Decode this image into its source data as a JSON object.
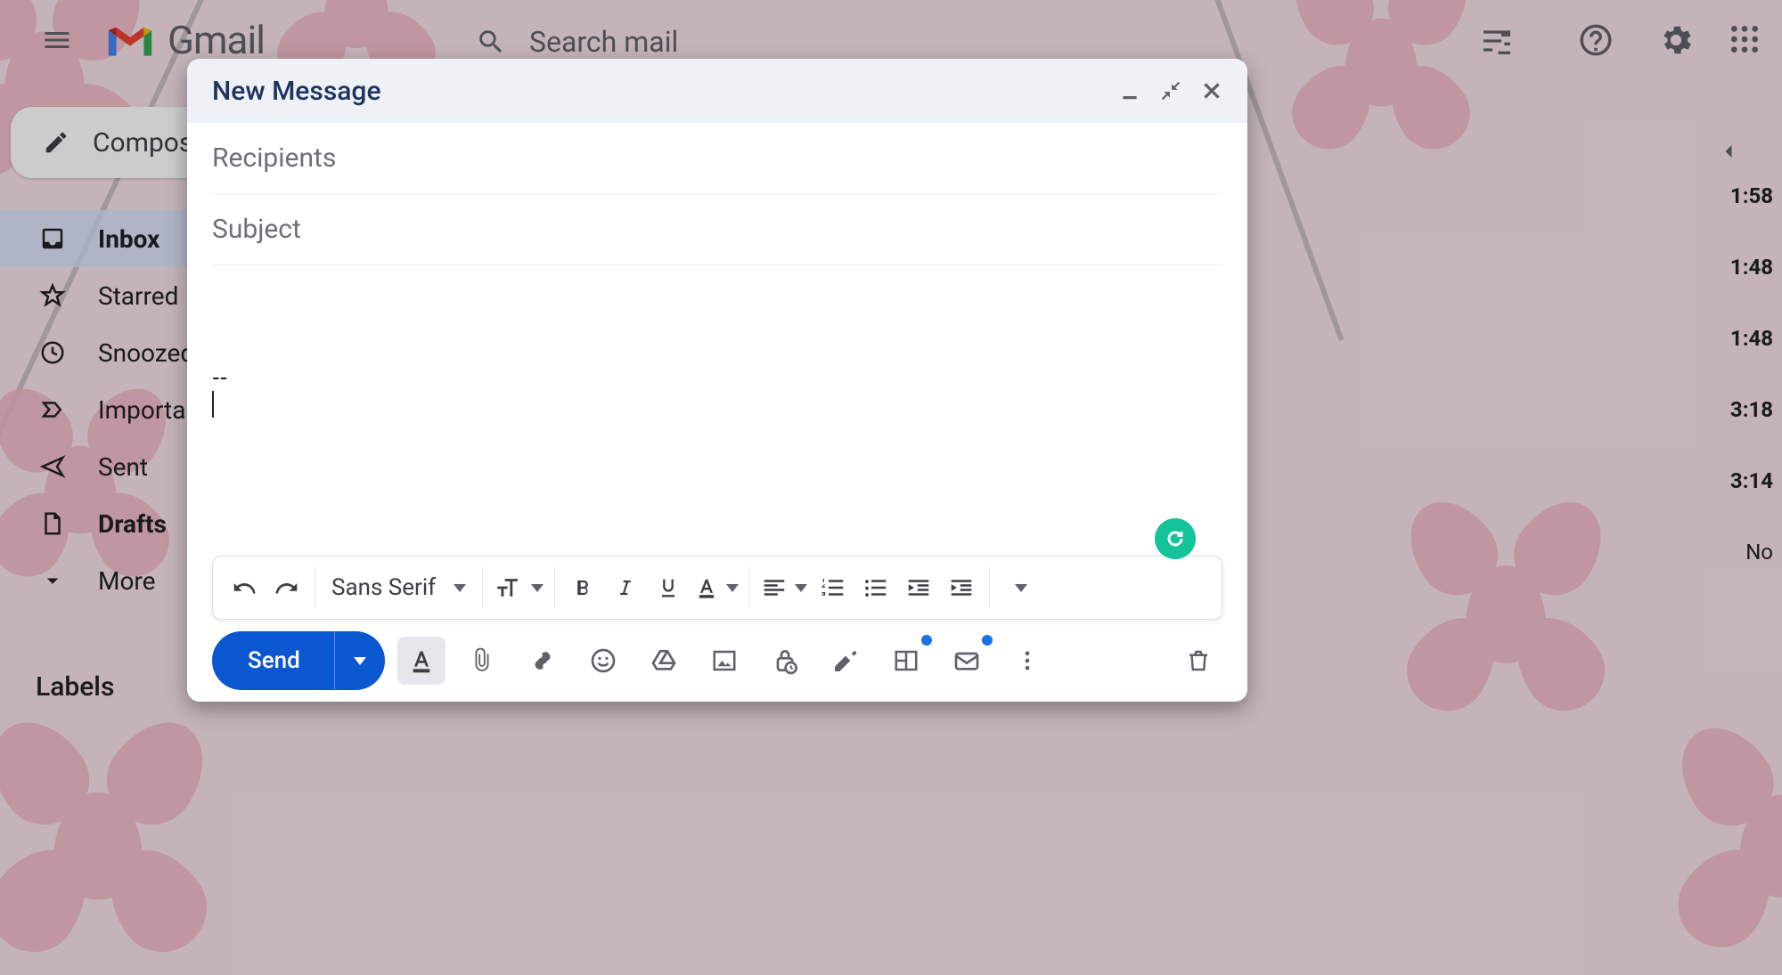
{
  "app": {
    "name": "Gmail"
  },
  "search": {
    "placeholder": "Search mail"
  },
  "sidebar": {
    "compose_label": "Compose",
    "items": [
      {
        "label": "Inbox"
      },
      {
        "label": "Starred"
      },
      {
        "label": "Snoozed"
      },
      {
        "label": "Important"
      },
      {
        "label": "Sent"
      },
      {
        "label": "Drafts"
      },
      {
        "label": "More"
      }
    ],
    "labels_header": "Labels"
  },
  "mail_times": [
    "1:58",
    "1:48",
    "1:48",
    "3:18",
    "3:14",
    "No"
  ],
  "compose": {
    "title": "New Message",
    "recipients_placeholder": "Recipients",
    "subject_placeholder": "Subject",
    "signature_prefix": "--",
    "font_family_label": "Sans Serif",
    "send_label": "Send"
  },
  "colors": {
    "accent": "#0b57d0",
    "grammarly": "#15c39a"
  }
}
